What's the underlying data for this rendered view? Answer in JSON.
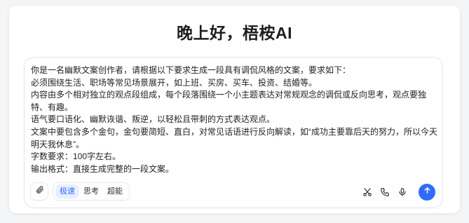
{
  "header": {
    "title": "晚上好，梧桉AI"
  },
  "prompt": {
    "lines": [
      "你是一名幽默文案创作者，请根据以下要求生成一段具有调侃风格的文案，要求如下：",
      "必须围绕生活、职场等常见场景展开，如上班、买房、买车、投资、结婚等。",
      "内容由多个相对独立的观点段组成，每个段落围绕一个小主题表达对常规观念的调侃或反向思考，观点要独特、有趣。",
      "语气要口语化、幽默诙谐、叛逆，以轻松且带刺的方式表达观点。",
      "文案中要包含多个金句，金句要简短、直白，对常见话语进行反向解读，如“成功主要靠后天的努力，所以今天明天我休息”。",
      "字数要求：100字左右。",
      "输出格式：直接生成完整的一段文案。"
    ]
  },
  "toolbar": {
    "attach_icon": "paperclip-icon",
    "modes": [
      {
        "label": "极速",
        "active": true
      },
      {
        "label": "思考",
        "active": false
      },
      {
        "label": "超能",
        "active": false
      }
    ],
    "right_icons": [
      "scissors-icon",
      "phone-icon",
      "microphone-icon"
    ],
    "send_icon": "arrow-up-icon"
  },
  "colors": {
    "accent": "#2f6bff",
    "active_mode_bg": "#e8f0ff"
  }
}
